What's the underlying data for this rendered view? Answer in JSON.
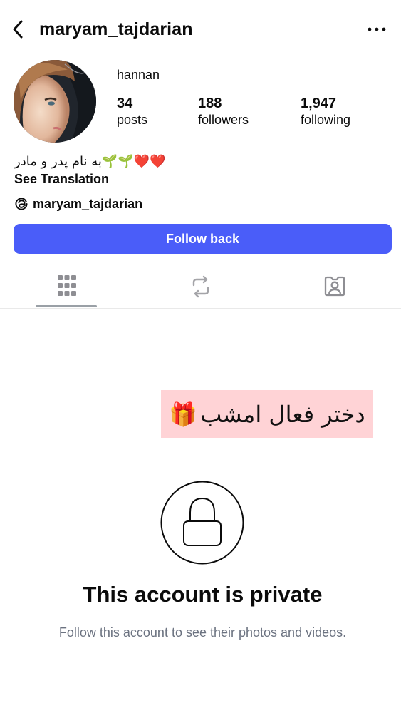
{
  "header": {
    "username": "maryam_tajdarian",
    "back_icon": "chevron-left-icon",
    "more_icon": "more-horizontal-icon"
  },
  "profile": {
    "display_name": "hannan",
    "stats": [
      {
        "value": "34",
        "label": "posts"
      },
      {
        "value": "188",
        "label": "followers"
      },
      {
        "value": "1,947",
        "label": "following"
      }
    ],
    "bio": "به نام پدر و مادر🌱🌱❤️❤️",
    "see_translation": "See Translation",
    "threads_handle": "maryam_tajdarian",
    "follow_button": "Follow back"
  },
  "tabs": [
    {
      "icon": "grid-icon",
      "selected": true
    },
    {
      "icon": "reposts-icon",
      "selected": false
    },
    {
      "icon": "tagged-icon",
      "selected": false
    }
  ],
  "overlay": {
    "text": "دختر فعال امشب",
    "emoji": "🎁",
    "background": "#ffd3d6"
  },
  "private_notice": {
    "title": "This account is private",
    "subtitle": "Follow this account to see their photos and videos."
  },
  "colors": {
    "accent": "#4a5df9",
    "text": "#0b0b0b",
    "muted": "#6b7280"
  }
}
